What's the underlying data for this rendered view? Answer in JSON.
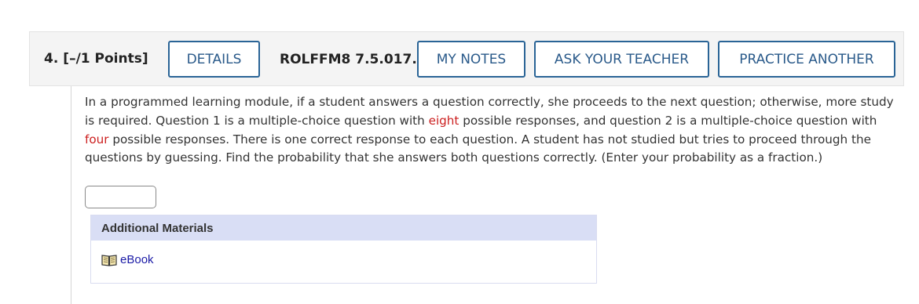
{
  "header": {
    "number": "4.",
    "points": "[–/1 Points]",
    "details_label": "DETAILS",
    "code": "ROLFFM8 7.5.017.",
    "my_notes_label": "MY NOTES",
    "ask_teacher_label": "ASK YOUR TEACHER",
    "practice_label": "PRACTICE ANOTHER"
  },
  "question": {
    "part1": "In a programmed learning module, if a student answers a question correctly, she proceeds to the next question; otherwise, more study is required. Question 1 is a multiple-choice question with ",
    "highlight1": "eight",
    "part2": " possible responses, and question 2 is a multiple-choice question with ",
    "highlight2": "four",
    "part3": " possible responses. There is one correct response to each question. A student has not studied but tries to proceed through the questions by guessing. Find the probability that she answers both questions correctly. (Enter your probability as a fraction.)",
    "highlight_color": "#cc1f1f"
  },
  "answer": {
    "value": ""
  },
  "materials": {
    "title": "Additional Materials",
    "ebook_label": "eBook",
    "ebook_icon": "book-icon"
  },
  "colors": {
    "button_border": "#2a6496",
    "button_text": "#2a5a8a",
    "materials_header_bg": "#d9def5",
    "link": "#1a1aa6"
  }
}
